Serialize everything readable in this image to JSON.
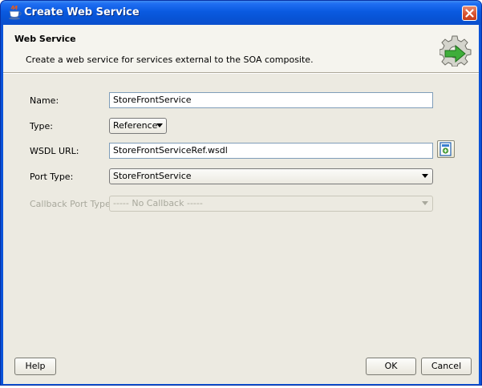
{
  "window": {
    "title": "Create Web Service"
  },
  "header": {
    "title": "Web Service",
    "description": "Create a web service for services external to the SOA composite."
  },
  "form": {
    "name_label": "Name:",
    "name_value": "StoreFrontService",
    "type_label": "Type:",
    "type_value": "Reference",
    "wsdl_label": "WSDL URL:",
    "wsdl_value": "StoreFrontServiceRef.wsdl",
    "port_type_label": "Port Type:",
    "port_type_value": "StoreFrontService",
    "callback_label": "Callback Port Type:",
    "callback_value": "----- No Callback -----"
  },
  "buttons": {
    "help": "Help",
    "ok": "OK",
    "cancel": "Cancel"
  },
  "icons": {
    "app": "java-cup-icon",
    "close": "close-icon",
    "header": "gear-arrow-icon",
    "browse": "browse-wsdl-icon"
  },
  "colors": {
    "titlebar": "#0a5ae0",
    "client": "#eceae1",
    "close_button": "#d6502c"
  }
}
